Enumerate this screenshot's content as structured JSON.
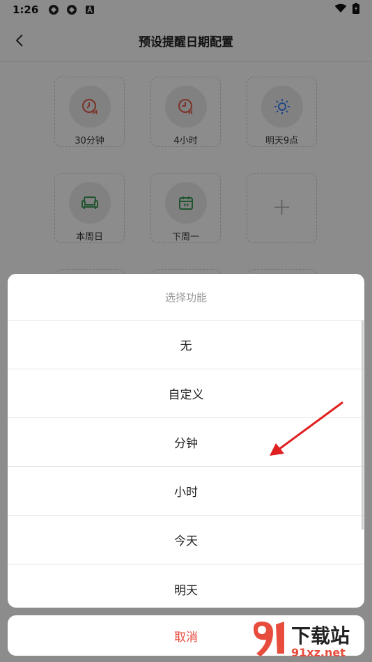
{
  "status_bar": {
    "time": "1:26"
  },
  "app_bar": {
    "title": "预设提醒日期配置"
  },
  "tiles": [
    {
      "label": "30分钟",
      "icon": "clock-m-icon",
      "color": "#e05a4a"
    },
    {
      "label": "4小时",
      "icon": "clock-h-icon",
      "color": "#e05a4a"
    },
    {
      "label": "明天9点",
      "icon": "sun-icon",
      "color": "#3b82f6"
    },
    {
      "label": "本周日",
      "icon": "sofa-icon",
      "color": "#3a9a55"
    },
    {
      "label": "下周一",
      "icon": "calendar-icon",
      "color": "#3a9a55"
    },
    {
      "label": "",
      "icon": "plus-icon",
      "color": "#aaaaaa"
    }
  ],
  "sheet": {
    "title": "选择功能",
    "options": [
      "无",
      "自定义",
      "分钟",
      "小时",
      "今天",
      "明天"
    ],
    "cancel": "取消"
  },
  "watermark": {
    "brand": "下载站",
    "site": "91xz.net"
  },
  "colors": {
    "accent_red": "#e74c3c",
    "annotation_arrow": "#e02020"
  }
}
